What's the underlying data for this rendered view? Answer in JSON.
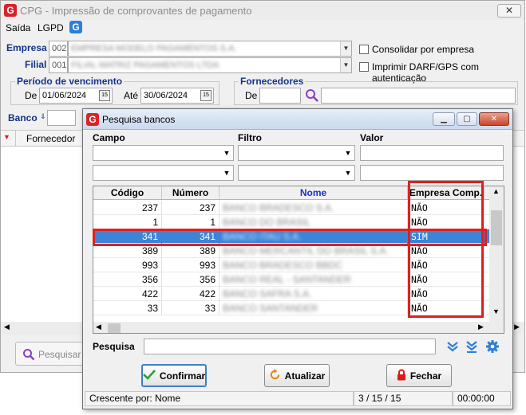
{
  "main_window": {
    "title": "CPG - Impressão de comprovantes de pagamento",
    "close_glyph": "✕",
    "menu": [
      "Saída",
      "LGPD"
    ],
    "empresa": {
      "label": "Empresa",
      "code": "002",
      "name": "EMPRESA MODELO PAGAMENTOS S.A."
    },
    "filial": {
      "label": "Filial",
      "code": "001",
      "name": "FILIAL MATRIZ PAGAMENTOS LTDA"
    },
    "consolidar_label": "Consolidar por empresa",
    "imprimir_darf_label": "Imprimir DARF/GPS com autenticação",
    "periodo": {
      "title": "Período de vencimento",
      "de_label": "De",
      "de_value": "01/06/2024",
      "ate_label": "Até",
      "ate_value": "30/06/2024",
      "cal_glyph": "15"
    },
    "fornecedores": {
      "title": "Fornecedores",
      "de_label": "De"
    },
    "banco_label": "Banco",
    "grid_header": "Fornecedor",
    "pesquisar_label": "Pesquisar"
  },
  "dialog": {
    "title": "Pesquisa bancos",
    "filters": {
      "campo_label": "Campo",
      "filtro_label": "Filtro",
      "valor_label": "Valor"
    },
    "columns": [
      "Código",
      "Número",
      "Nome",
      "Empresa Comp."
    ],
    "rows": [
      {
        "codigo": "237",
        "numero": "237",
        "nome": "BANCO BRADESCO S.A.",
        "empresa_comp": "NÃO"
      },
      {
        "codigo": "1",
        "numero": "1",
        "nome": "BANCO DO BRASIL",
        "empresa_comp": "NÃO"
      },
      {
        "codigo": "341",
        "numero": "341",
        "nome": "BANCO ITAU S.A.",
        "empresa_comp": "SIM"
      },
      {
        "codigo": "389",
        "numero": "389",
        "nome": "BANCO MERCANTIL DO BRASIL S.A.",
        "empresa_comp": "NÃO"
      },
      {
        "codigo": "993",
        "numero": "993",
        "nome": "BANCO BRADESCO BBDC",
        "empresa_comp": "NÃO"
      },
      {
        "codigo": "356",
        "numero": "356",
        "nome": "BANCO REAL - SANTANDER",
        "empresa_comp": "NÃO"
      },
      {
        "codigo": "422",
        "numero": "422",
        "nome": "BANCO SAFRA S.A.",
        "empresa_comp": "NÃO"
      },
      {
        "codigo": "33",
        "numero": "33",
        "nome": "BANCO SANTANDER",
        "empresa_comp": "NÃO"
      }
    ],
    "selected_index": 2,
    "pesquisa_label": "Pesquisa",
    "buttons": {
      "confirmar": "Confirmar",
      "atualizar": "Atualizar",
      "fechar": "Fechar"
    },
    "status": {
      "order": "Crescente por: Nome",
      "position": "3 / 15 / 15",
      "time": "00:00:00"
    }
  },
  "colors": {
    "accent_red": "#e02020",
    "selection": "#3c84d8",
    "title_blue": "#14338a",
    "brand": "#d8232a"
  }
}
